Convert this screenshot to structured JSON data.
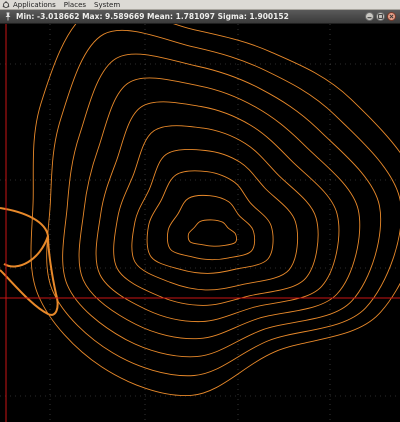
{
  "top_panel": {
    "menus": [
      "Applications",
      "Places",
      "System"
    ]
  },
  "window": {
    "title": "Min: -3.018662 Max: 9.589669 Mean: 1.781097 Sigma: 1.900152"
  },
  "plot": {
    "background_color": "#000000",
    "contour_color": "#e8892a",
    "crosshair_color": "#c81414",
    "grid_color": "#ffffff",
    "grid": true
  },
  "icons": {
    "logo": "ubuntu-logo-icon",
    "window_menu": "pin-icon",
    "minimize": "minimize-icon",
    "maximize": "maximize-icon",
    "close": "close-icon"
  }
}
